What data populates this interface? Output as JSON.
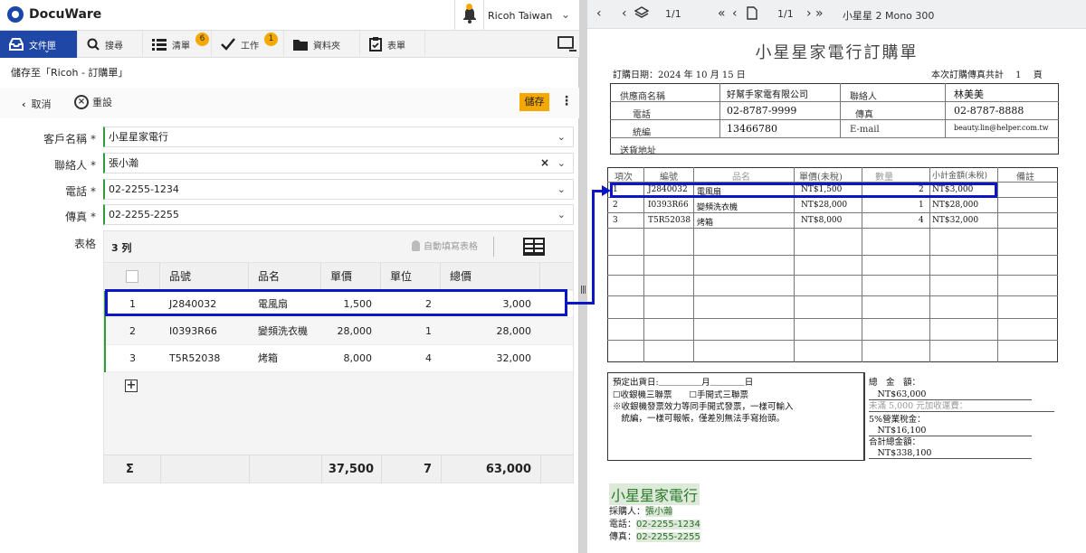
{
  "app": {
    "brand": "DocuWare",
    "org": "Ricoh Taiwan"
  },
  "nav": {
    "items": [
      {
        "label": "文件匣",
        "icon": "inbox-icon"
      },
      {
        "label": "搜尋",
        "icon": "search-icon"
      },
      {
        "label": "清單",
        "icon": "list-icon",
        "badge": "6"
      },
      {
        "label": "工作",
        "icon": "checkmark-icon",
        "badge": "1"
      },
      {
        "label": "資料夾",
        "icon": "folder-icon"
      },
      {
        "label": "表單",
        "icon": "form-icon"
      }
    ]
  },
  "form": {
    "store_title": "儲存至「Ricoh - 訂購單」",
    "cancel": "取消",
    "reset": "重設",
    "save": "儲存",
    "fields": [
      {
        "label": "客戶名稱 *",
        "value": "小星星家電行"
      },
      {
        "label": "聯絡人 *",
        "value": "張小瀚"
      },
      {
        "label": "電話 *",
        "value": "02-2255-1234"
      },
      {
        "label": "傳真 *",
        "value": "02-2255-2255"
      }
    ],
    "table_label": "表格",
    "row_count": "3 列",
    "autofill": "自動填寫表格",
    "columns": [
      "品號",
      "品名",
      "單價",
      "單位",
      "總價"
    ],
    "rows": [
      {
        "no": "1",
        "code": "J2840032",
        "name": "電風扇",
        "price": "1,500",
        "qty": "2",
        "total": "3,000"
      },
      {
        "no": "2",
        "code": "I0393R66",
        "name": "變頻洗衣機",
        "price": "28,000",
        "qty": "1",
        "total": "28,000"
      },
      {
        "no": "3",
        "code": "T5R52038",
        "name": "烤箱",
        "price": "8,000",
        "qty": "4",
        "total": "32,000"
      }
    ],
    "sum": {
      "symbol": "Σ",
      "price": "37,500",
      "qty": "7",
      "total": "63,000"
    }
  },
  "viewer": {
    "page": "1/1",
    "page2": "1/1",
    "doc_name": "小星星 2 Mono 300"
  },
  "doc": {
    "title": "小星星家電行訂購單",
    "date": "訂購日期：2024 年 10 月 15 日",
    "pages": "本次訂購傳真共計　 1 　頁",
    "supplier_label": "供應商名稱",
    "supplier": "好幫手家電有限公司",
    "contact_label": "聯絡人",
    "contact": "林美美",
    "phone_label": "電話",
    "phone": "02-8787-9999",
    "fax_label": "傳真",
    "fax": "02-8787-8888",
    "taxid_label": "統編",
    "taxid": "13466780",
    "email_label": "E-mail",
    "email": "beauty.lin@helper.com.tw",
    "ship_label": "送貨地址",
    "headers": [
      "項次",
      "編號",
      "品名",
      "單價(未稅)",
      "數量",
      "小計金額(未稅)",
      "備註"
    ],
    "rows": [
      {
        "no": "1",
        "code": "J2840032",
        "name": "電風扇",
        "price": "NT$1,500",
        "qty": "2",
        "total": "NT$3,000"
      },
      {
        "no": "2",
        "code": "I0393R66",
        "name": "變頻洗衣機",
        "price": "NT$28,000",
        "qty": "1",
        "total": "NT$28,000"
      },
      {
        "no": "3",
        "code": "T5R52038",
        "name": "烤箱",
        "price": "NT$8,000",
        "qty": "4",
        "total": "NT$32,000"
      }
    ],
    "notes": [
      "預定出貨日:＿＿＿＿＿月＿＿＿＿日",
      "☐收銀機三聯票　　☐手開式三聯票",
      "※收銀機發票效力等同手開式發票，一樣可輸入",
      "　統編，一樣可報帳，僅差別無法手寫抬頭。"
    ],
    "totals": [
      "總　金　額：",
      "　NT$63,000",
      "未滿 5,000 元加收運費：",
      "5%營業稅金：",
      "　NT$16,100",
      "合計總金額：",
      "　NT$338,100"
    ],
    "stamp": "小星星家電行",
    "buyer_label": "採購人：",
    "buyer": "張小瀚",
    "tel_label": "電話：",
    "tel": "02-2255-1234",
    "fax2_label": "傳真：",
    "fax2": "02-2255-2255"
  }
}
